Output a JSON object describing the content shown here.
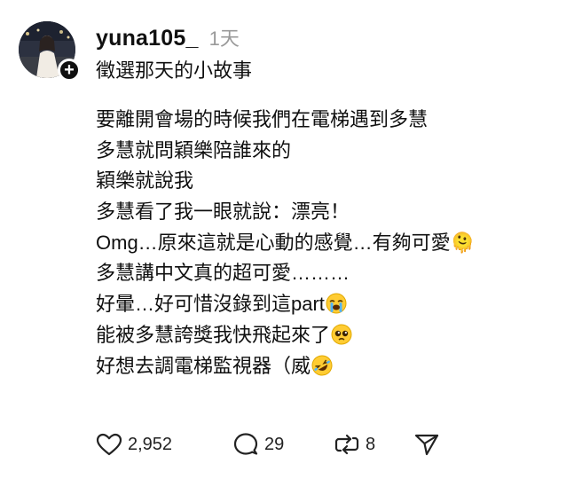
{
  "post": {
    "username": "yuna105_",
    "time": "1天",
    "caption": "徵選那天的小故事",
    "lines": [
      "要離開會場的時候我們在電梯遇到多慧",
      "多慧就問穎樂陪誰來的",
      "穎樂就說我",
      "多慧看了我一眼就說：漂亮！",
      "Omg…原來這就是心動的感覺…有夠可愛🫠",
      "多慧講中文真的超可愛………",
      "好暈…好可惜沒錄到這part",
      "能被多慧誇獎我快飛起來了",
      "好想去調電梯監視器（威"
    ],
    "line_emojis": [
      "",
      "",
      "",
      "",
      "",
      "",
      "loudly-crying-face",
      "pleading-face",
      "rolling-on-floor-laughing-face"
    ],
    "follow_badge": "+"
  },
  "actions": {
    "likes": "2,952",
    "replies": "29",
    "reposts": "8"
  }
}
